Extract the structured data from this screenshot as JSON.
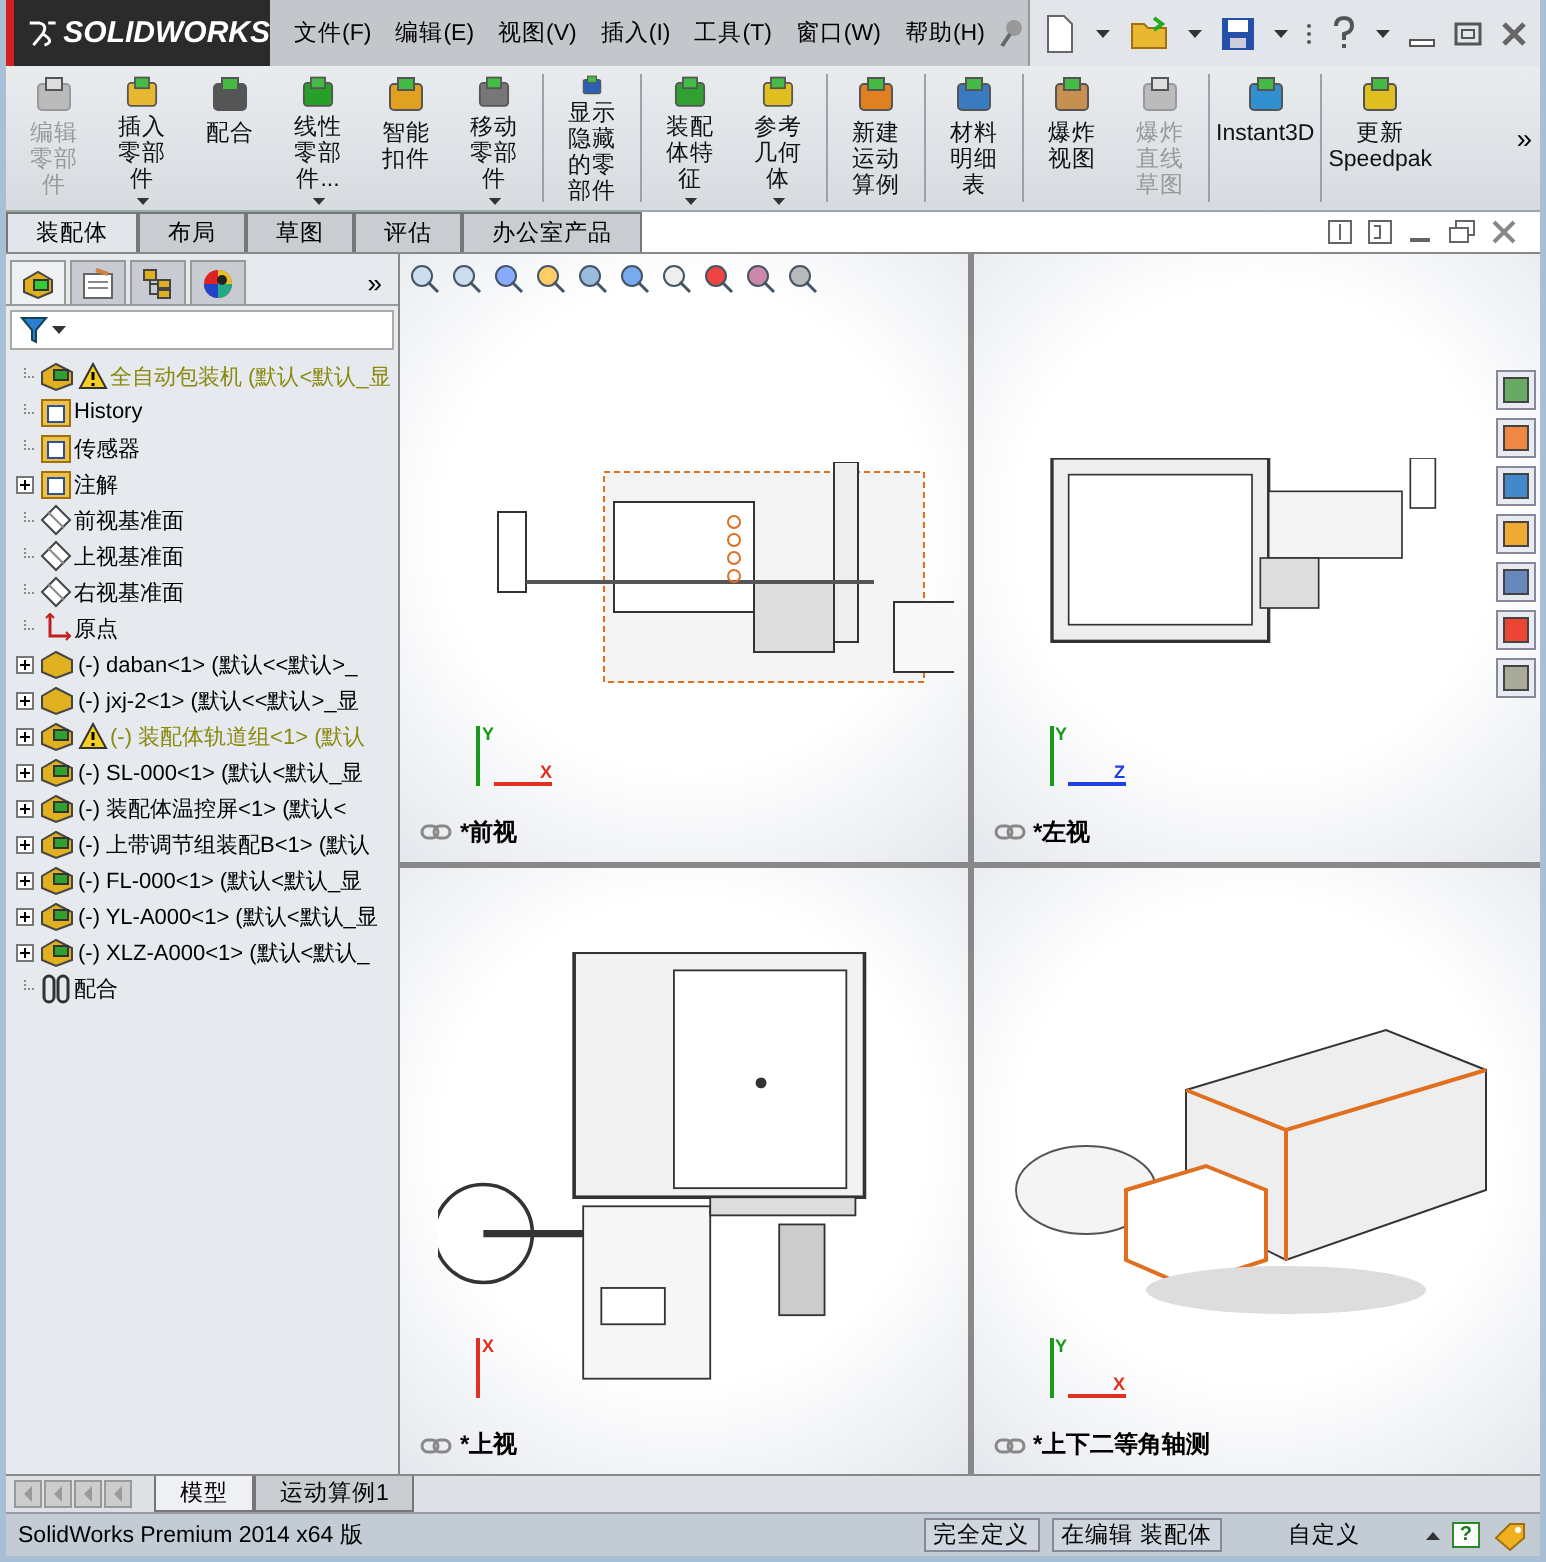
{
  "logo": {
    "text": "SOLIDWORKS"
  },
  "menu": [
    {
      "label": "文件(F)"
    },
    {
      "label": "编辑(E)"
    },
    {
      "label": "视图(V)"
    },
    {
      "label": "插入(I)"
    },
    {
      "label": "工具(T)"
    },
    {
      "label": "窗口(W)"
    },
    {
      "label": "帮助(H)"
    }
  ],
  "ribbon": [
    {
      "kind": "button",
      "label": "编辑零部件",
      "disabled": true,
      "dropdown": false
    },
    {
      "kind": "button",
      "label": "插入零部件",
      "disabled": false,
      "dropdown": true
    },
    {
      "kind": "button",
      "label": "配合",
      "disabled": false,
      "dropdown": false
    },
    {
      "kind": "button",
      "label": "线性零部件...",
      "disabled": false,
      "dropdown": true
    },
    {
      "kind": "button",
      "label": "智能扣件",
      "disabled": false,
      "dropdown": false
    },
    {
      "kind": "button",
      "label": "移动零部件",
      "disabled": false,
      "dropdown": true
    },
    {
      "kind": "separator"
    },
    {
      "kind": "button",
      "label": "显示隐藏的零部件",
      "disabled": false,
      "dropdown": false
    },
    {
      "kind": "separator"
    },
    {
      "kind": "button",
      "label": "装配体特征",
      "disabled": false,
      "dropdown": true
    },
    {
      "kind": "button",
      "label": "参考几何体",
      "disabled": false,
      "dropdown": true
    },
    {
      "kind": "separator"
    },
    {
      "kind": "button",
      "label": "新建运动算例",
      "disabled": false,
      "dropdown": false
    },
    {
      "kind": "separator"
    },
    {
      "kind": "button",
      "label": "材料明细表",
      "disabled": false,
      "dropdown": false
    },
    {
      "kind": "separator"
    },
    {
      "kind": "button",
      "label": "爆炸视图",
      "disabled": false,
      "dropdown": false
    },
    {
      "kind": "button",
      "label": "爆炸直线草图",
      "disabled": true,
      "dropdown": false
    },
    {
      "kind": "separator"
    },
    {
      "kind": "button",
      "label": "Instant3D",
      "disabled": false,
      "dropdown": false
    },
    {
      "kind": "separator"
    },
    {
      "kind": "button",
      "label": "更新 Speedpak",
      "disabled": false,
      "dropdown": false
    },
    {
      "kind": "more",
      "label": "»"
    }
  ],
  "tabs": [
    {
      "label": "装配体",
      "selected": true
    },
    {
      "label": "布局",
      "selected": false
    },
    {
      "label": "草图",
      "selected": false
    },
    {
      "label": "评估",
      "selected": false
    },
    {
      "label": "办公室产品",
      "selected": false
    }
  ],
  "panel": {
    "tabs": [
      {
        "selected": true
      },
      {
        "selected": false
      },
      {
        "selected": false
      },
      {
        "selected": false
      }
    ],
    "expand": "»"
  },
  "tree": [
    {
      "kind": "root",
      "label": "全自动包装机 (默认<默认_显",
      "warning": true,
      "expandable": false
    },
    {
      "kind": "history",
      "label": "History",
      "warning": false,
      "expandable": false
    },
    {
      "kind": "sensor",
      "label": "传感器",
      "warning": false,
      "expandable": false
    },
    {
      "kind": "annotation",
      "label": "注解",
      "warning": false,
      "expandable": true
    },
    {
      "kind": "plane",
      "label": "前视基准面",
      "warning": false,
      "expandable": false
    },
    {
      "kind": "plane",
      "label": "上视基准面",
      "warning": false,
      "expandable": false
    },
    {
      "kind": "plane",
      "label": "右视基准面",
      "warning": false,
      "expandable": false
    },
    {
      "kind": "origin",
      "label": "原点",
      "warning": false,
      "expandable": false
    },
    {
      "kind": "part",
      "label": "(-) daban<1> (默认<<默认>_",
      "warning": false,
      "expandable": true
    },
    {
      "kind": "part",
      "label": "(-) jxj-2<1> (默认<<默认>_显",
      "warning": false,
      "expandable": true
    },
    {
      "kind": "assembly",
      "label": "(-) 装配体轨道组<1> (默认",
      "warning": true,
      "expandable": true
    },
    {
      "kind": "assembly",
      "label": "(-) SL-000<1> (默认<默认_显",
      "warning": false,
      "expandable": true
    },
    {
      "kind": "assembly",
      "label": "(-) 装配体温控屏<1> (默认<",
      "warning": false,
      "expandable": true
    },
    {
      "kind": "assembly",
      "label": "(-) 上带调节组装配B<1> (默认",
      "warning": false,
      "expandable": true
    },
    {
      "kind": "assembly",
      "label": "(-) FL-000<1> (默认<默认_显",
      "warning": false,
      "expandable": true
    },
    {
      "kind": "assembly",
      "label": "(-) YL-A000<1> (默认<默认_显",
      "warning": false,
      "expandable": true
    },
    {
      "kind": "assembly",
      "label": "(-) XLZ-A000<1> (默认<默认_",
      "warning": false,
      "expandable": true
    },
    {
      "kind": "mates",
      "label": "配合",
      "warning": false,
      "expandable": false
    }
  ],
  "viewports": [
    {
      "kind": "front",
      "label": "*前视",
      "axes": [
        {
          "label": "Y",
          "color": "#1a9a1a"
        },
        {
          "label": "X",
          "color": "#e03020"
        }
      ]
    },
    {
      "kind": "left",
      "label": "*左视",
      "axes": [
        {
          "label": "Y",
          "color": "#1a9a1a"
        },
        {
          "label": "Z",
          "color": "#2040e0"
        }
      ]
    },
    {
      "kind": "top",
      "label": "*上视",
      "axes": [
        {
          "label": "X",
          "color": "#e03020"
        }
      ]
    },
    {
      "kind": "iso",
      "label": "*上下二等角轴测",
      "axes": [
        {
          "label": "Y",
          "color": "#1a9a1a"
        },
        {
          "label": "X",
          "color": "#e03020"
        }
      ]
    }
  ],
  "bottom_tabs": [
    {
      "label": "模型",
      "selected": true
    },
    {
      "label": "运动算例1",
      "selected": false
    }
  ],
  "status_bar": {
    "product": "SolidWorks Premium 2014 x64 版",
    "state": "完全定义",
    "mode": "在编辑 装配体",
    "units": "自定义",
    "help": "?"
  }
}
